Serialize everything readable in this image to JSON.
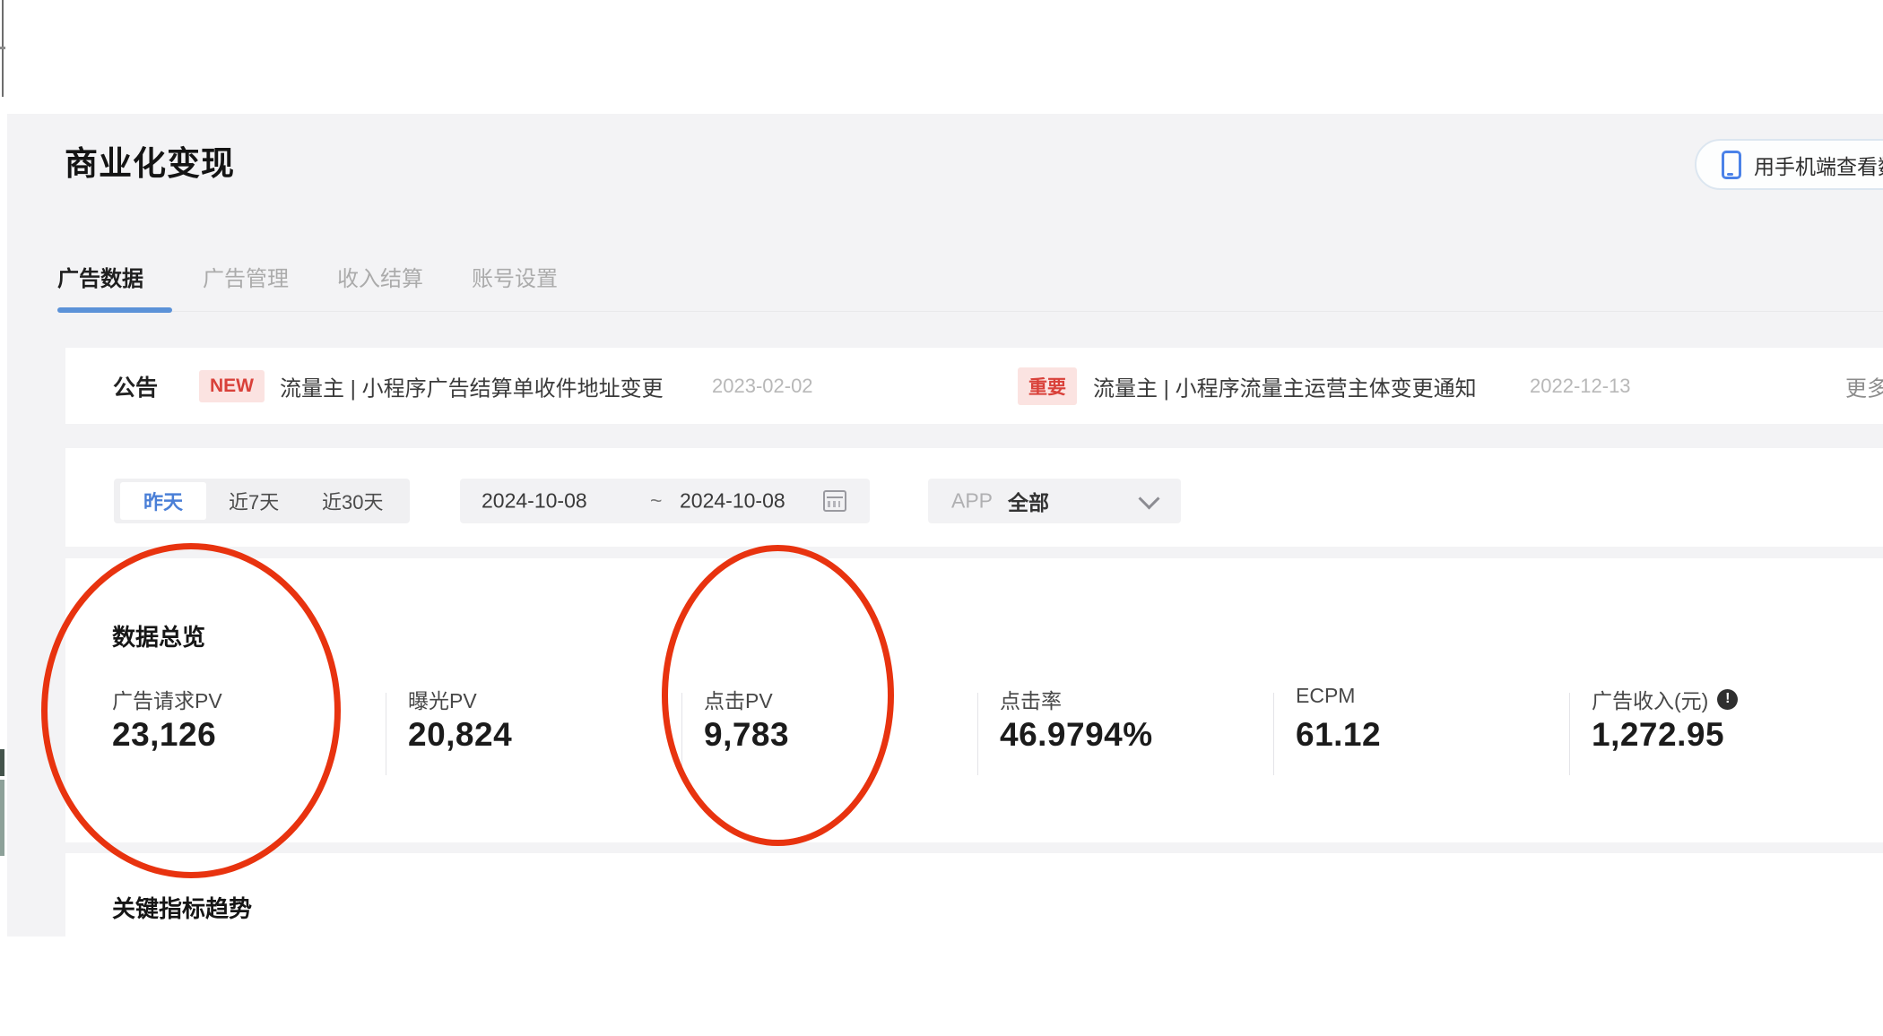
{
  "page": {
    "title": "商业化变现"
  },
  "header": {
    "mobile_button_label": "用手机端查看数据"
  },
  "tabs": [
    {
      "label": "广告数据",
      "active": true
    },
    {
      "label": "广告管理",
      "active": false
    },
    {
      "label": "收入结算",
      "active": false
    },
    {
      "label": "账号设置",
      "active": false
    }
  ],
  "announcement": {
    "label": "公告",
    "items": [
      {
        "badge": "NEW",
        "text": "流量主 | 小程序广告结算单收件地址变更",
        "date": "2023-02-02"
      },
      {
        "badge": "重要",
        "text": "流量主 | 小程序流量主运营主体变更通知",
        "date": "2022-12-13"
      }
    ],
    "more_label": "更多"
  },
  "filters": {
    "quick_ranges": [
      {
        "label": "昨天",
        "active": true
      },
      {
        "label": "近7天",
        "active": false
      },
      {
        "label": "近30天",
        "active": false
      }
    ],
    "date_start": "2024-10-08",
    "date_separator": "~",
    "date_end": "2024-10-08",
    "app_label": "APP",
    "app_value": "全部"
  },
  "overview": {
    "title": "数据总览",
    "metrics": [
      {
        "label": "广告请求PV",
        "value": "23,126"
      },
      {
        "label": "曝光PV",
        "value": "20,824"
      },
      {
        "label": "点击PV",
        "value": "9,783"
      },
      {
        "label": "点击率",
        "value": "46.9794%"
      },
      {
        "label": "ECPM",
        "value": "61.12"
      },
      {
        "label": "广告收入(元)",
        "value": "1,272.95"
      }
    ],
    "info_icon_glyph": "!"
  },
  "trend": {
    "title": "关键指标趋势"
  },
  "colors": {
    "accent_blue": "#5b92d8",
    "active_text_blue": "#4a7fd7",
    "badge_red": "#d9413a",
    "badge_bg": "#fbe3e1",
    "annotation_red": "#e8330f",
    "panel_gray": "#f3f3f5"
  },
  "annotations": {
    "circled_metrics": [
      "广告请求PV",
      "点击PV"
    ]
  }
}
